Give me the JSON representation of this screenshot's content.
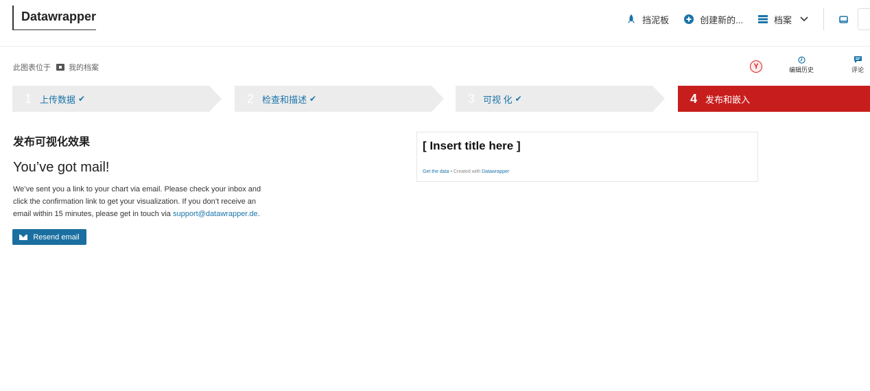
{
  "header": {
    "logo": "Datawrapper",
    "nav": {
      "dashboard": "挡泥板",
      "create_new": "创建新的...",
      "archive": "档案"
    }
  },
  "breadcrumb": {
    "prefix": "此图表位于",
    "folder": "我的档案"
  },
  "tools": {
    "history": "编辑历史",
    "comments": "评论",
    "avatar_letter": "Y"
  },
  "steps": [
    {
      "num": "1",
      "label": "上传数据"
    },
    {
      "num": "2",
      "label": "检查和描述"
    },
    {
      "num": "3",
      "label": "可视 化"
    },
    {
      "num": "4",
      "label": "发布和嵌入"
    }
  ],
  "publish": {
    "section_title": "发布可视化效果",
    "heading": "You’ve got mail!",
    "text_before": "We’ve sent you a link to your chart via email. Please check your inbox and click the confirmation link to get your visualization. If you don’t receive an email within 15 minutes, please get in touch via ",
    "support_link": "support@datawrapper.de",
    "text_after": ".",
    "resend_label": "Resend email"
  },
  "preview": {
    "title": "[ Insert title here ]",
    "get_data": "Get the data",
    "created_with": " • Created with ",
    "brand": "Datawrapper"
  },
  "colors": {
    "accent_blue": "#1a74a8",
    "active_red": "#c71e1d",
    "step_gray": "#ececec"
  }
}
